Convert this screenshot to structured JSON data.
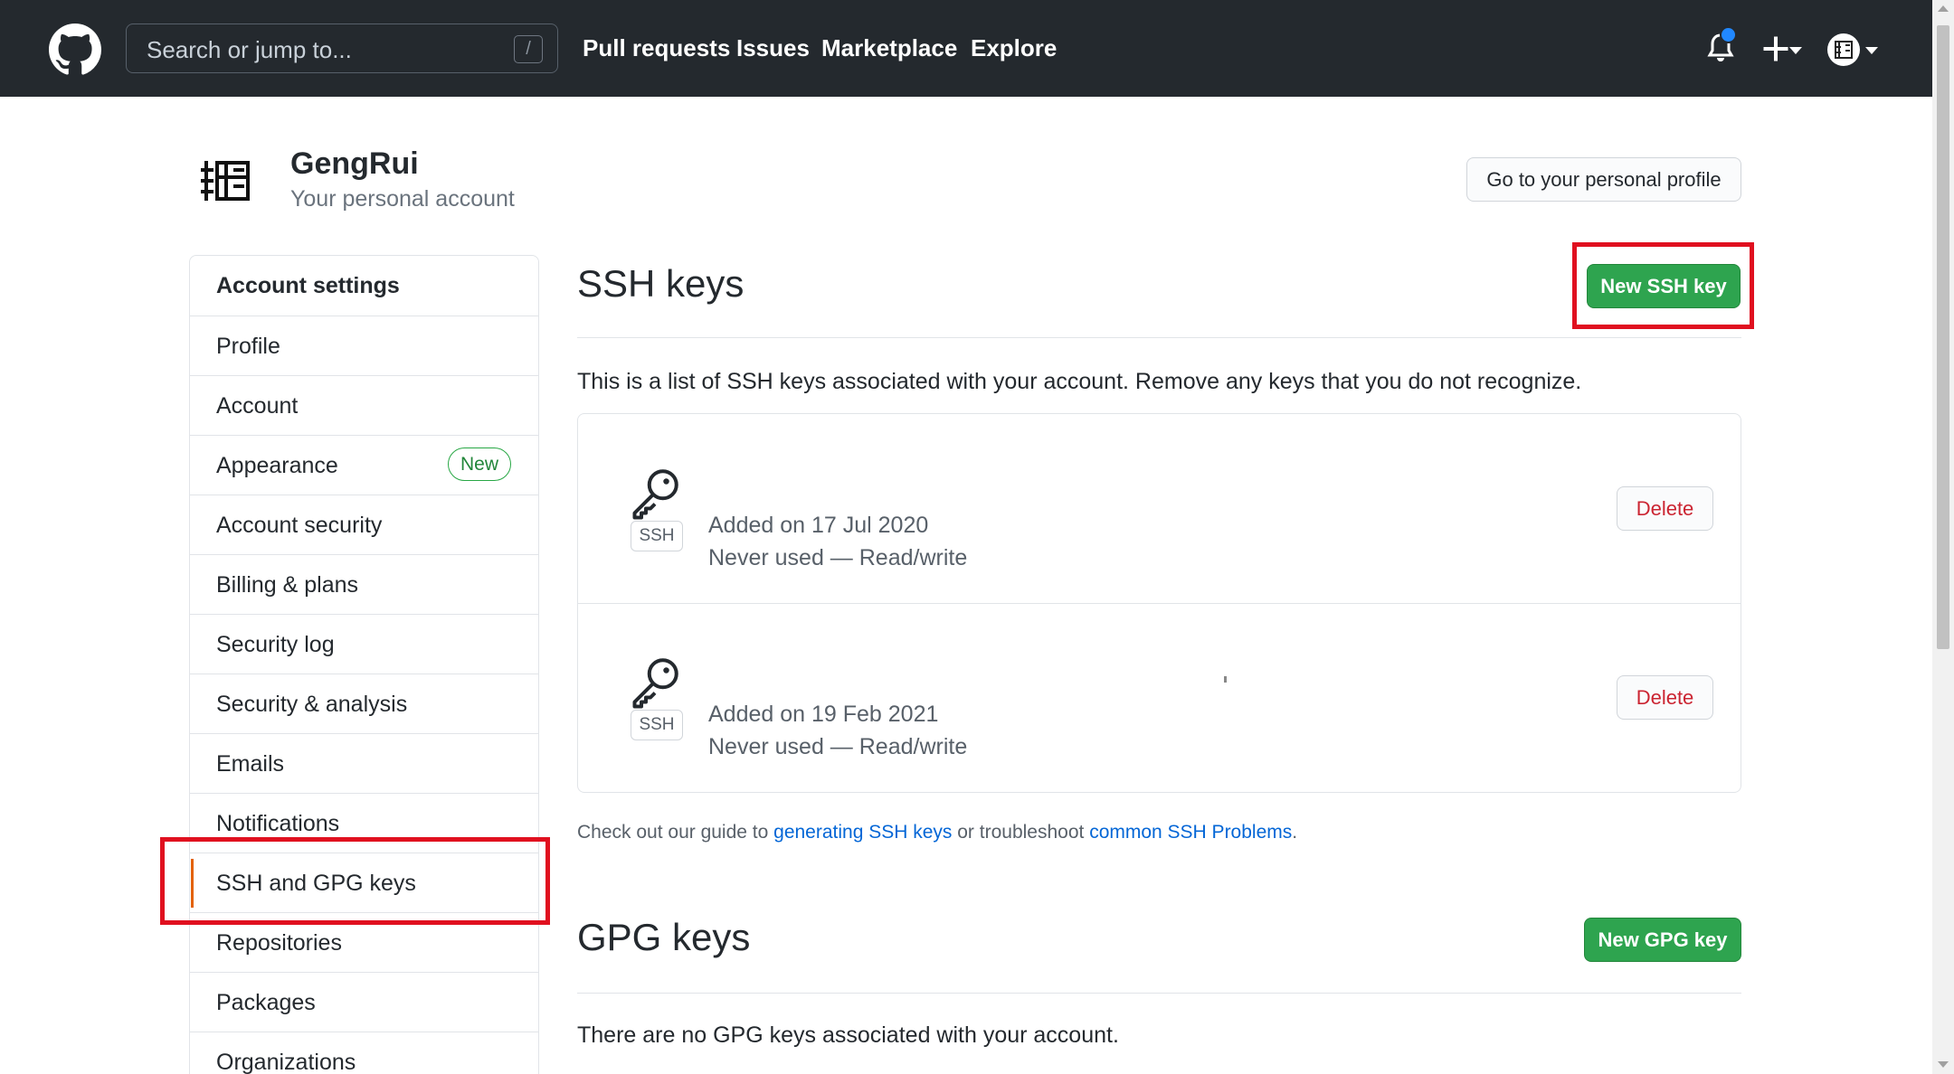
{
  "header": {
    "search_placeholder": "Search or jump to...",
    "search_shortcut": "/",
    "nav": [
      "Pull requests",
      "Issues",
      "Marketplace",
      "Explore"
    ],
    "notification_dot_color": "#2188ff"
  },
  "account": {
    "name": "GengRui",
    "subtitle": "Your personal account",
    "profile_button": "Go to your personal profile"
  },
  "sidebar": {
    "heading": "Account settings",
    "items": [
      {
        "label": "Profile"
      },
      {
        "label": "Account"
      },
      {
        "label": "Appearance",
        "badge": "New"
      },
      {
        "label": "Account security"
      },
      {
        "label": "Billing & plans"
      },
      {
        "label": "Security log"
      },
      {
        "label": "Security & analysis"
      },
      {
        "label": "Emails"
      },
      {
        "label": "Notifications"
      },
      {
        "label": "SSH and GPG keys",
        "selected": true
      },
      {
        "label": "Repositories"
      },
      {
        "label": "Packages"
      },
      {
        "label": "Organizations"
      }
    ]
  },
  "ssh": {
    "title": "SSH keys",
    "new_button": "New SSH key",
    "description": "This is a list of SSH keys associated with your account. Remove any keys that you do not recognize.",
    "keys": [
      {
        "type_label": "SSH",
        "added": "Added on 17 Jul 2020",
        "usage": "Never used — Read/write",
        "delete_label": "Delete"
      },
      {
        "type_label": "SSH",
        "added": "Added on 19 Feb 2021",
        "usage": "Never used — Read/write",
        "delete_label": "Delete"
      }
    ],
    "guide": {
      "prefix": "Check out our guide to ",
      "link1": "generating SSH keys",
      "middle": " or troubleshoot ",
      "link2": "common SSH Problems",
      "suffix": "."
    }
  },
  "gpg": {
    "title": "GPG keys",
    "new_button": "New GPG key",
    "description": "There are no GPG keys associated with your account."
  },
  "colors": {
    "header_bg": "#24292e",
    "primary_green": "#2ea44f",
    "danger_red": "#cb2431",
    "highlight_red": "#e0101f",
    "link_blue": "#0366d6",
    "selected_accent": "#e36209"
  }
}
